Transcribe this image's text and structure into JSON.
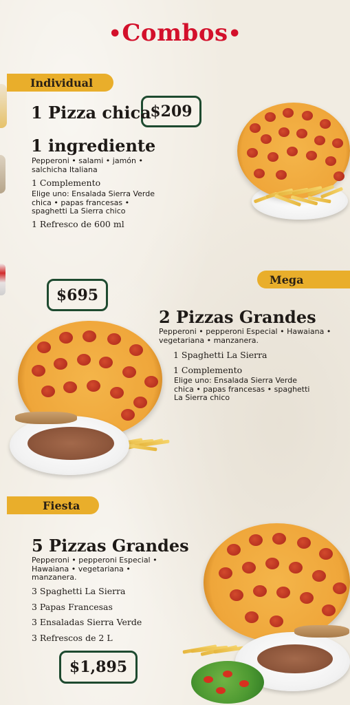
{
  "header": {
    "title": "Combos",
    "dot_left": "•",
    "dot_right": "•"
  },
  "individual": {
    "tag": "Individual",
    "price": "$209",
    "title": "1 Pizza chica",
    "subtitle": "1 ingrediente",
    "flavors": "Pepperoni • salami • jamón • salchicha Italiana",
    "complement_title": "1 Complemento",
    "choose": "Elige uno: Ensalada Sierra Verde chica • papas francesas • spaghetti La Sierra chico",
    "soda": "1 Refresco de 600 ml"
  },
  "mega": {
    "tag": "Mega",
    "price": "$695",
    "title": "2 Pizzas Grandes",
    "flavors": "Pepperoni • pepperoni Especial • Hawaiana • vegetariana • manzanera.",
    "spaghetti": "1 Spaghetti La Sierra",
    "complement_title": "1 Complemento",
    "choose": "Elige uno: Ensalada Sierra Verde chica • papas francesas • spaghetti La Sierra chico"
  },
  "fiesta": {
    "tag": "Fiesta",
    "price": "$1,895",
    "title": "5 Pizzas Grandes",
    "flavors": "Pepperoni • pepperoni Especial • Hawaiana • vegetariana • manzanera.",
    "items": [
      "3 Spaghetti La Sierra",
      "3 Papas Francesas",
      "3 Ensaladas Sierra Verde",
      "3 Refrescos de 2 L"
    ]
  },
  "colors": {
    "title_red": "#d3102b",
    "tag_yellow": "#e9ae2b",
    "badge_border": "#1e4a2f",
    "background": "#f1ece2"
  }
}
